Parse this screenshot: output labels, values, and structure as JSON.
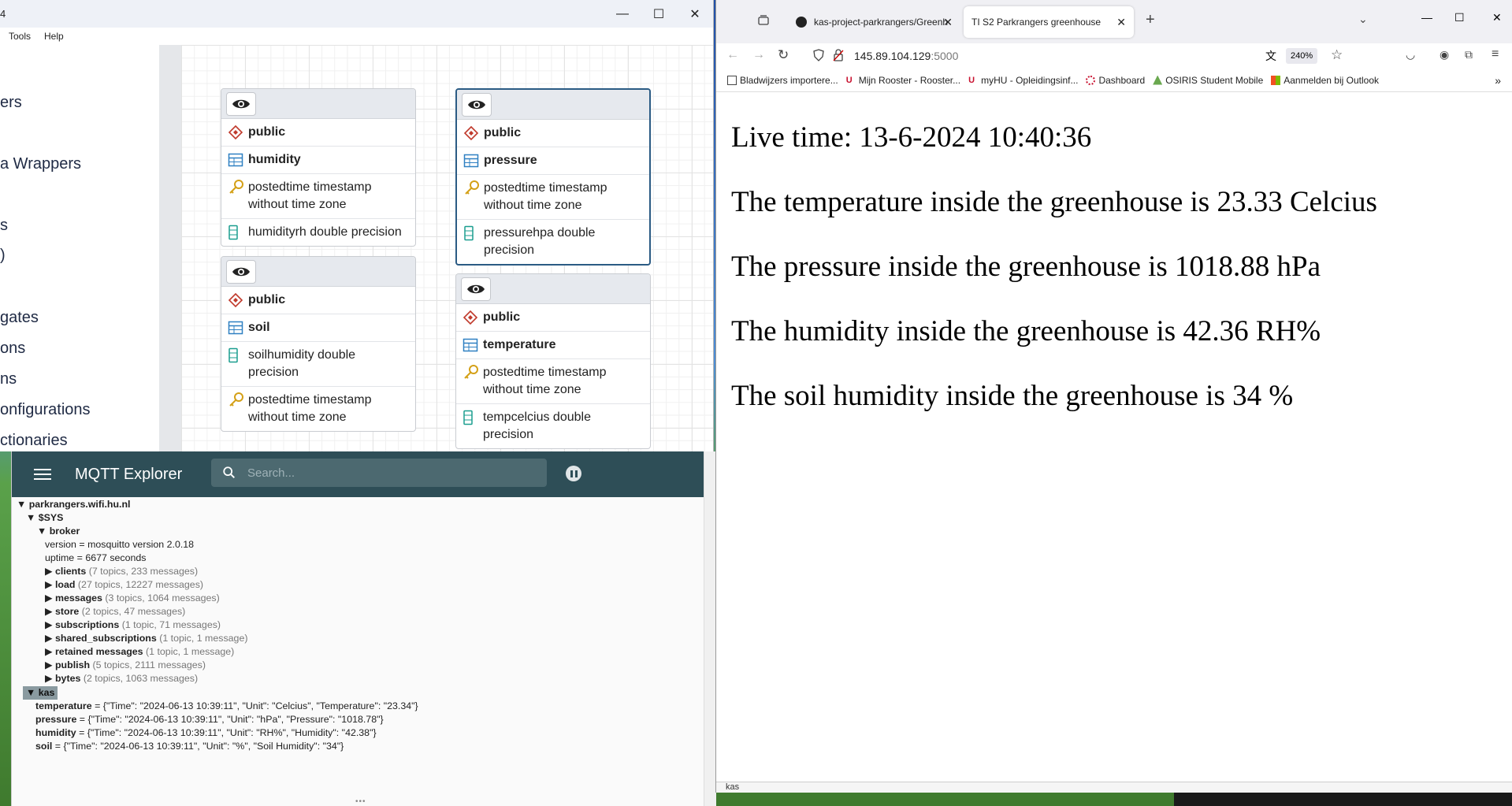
{
  "pgadmin": {
    "title": "4",
    "menu": [
      "Tools",
      "Help"
    ],
    "tree_items": [
      "ers",
      "a Wrappers",
      "s",
      ")",
      "gates",
      "ons",
      "ns",
      "onfigurations",
      "ctionaries"
    ],
    "nodes": [
      {
        "schema": "public",
        "table": "humidity",
        "rows": [
          {
            "icon": "key",
            "text": "postedtime timestamp without time zone"
          },
          {
            "icon": "column",
            "text": "humidityrh double precision"
          }
        ]
      },
      {
        "schema": "public",
        "table": "pressure",
        "rows": [
          {
            "icon": "key",
            "text": "postedtime timestamp without time zone"
          },
          {
            "icon": "column",
            "text": "pressurehpa double precision"
          }
        ]
      },
      {
        "schema": "public",
        "table": "soil",
        "rows": [
          {
            "icon": "column",
            "text": "soilhumidity double precision"
          },
          {
            "icon": "key",
            "text": "postedtime timestamp without time zone"
          }
        ]
      },
      {
        "schema": "public",
        "table": "temperature",
        "rows": [
          {
            "icon": "key",
            "text": "postedtime timestamp without time zone"
          },
          {
            "icon": "column",
            "text": "tempcelcius double precision"
          }
        ]
      }
    ]
  },
  "mqtt": {
    "title": "MQTT Explorer",
    "search_placeholder": "Search...",
    "root": "parkrangers.wifi.hu.nl",
    "sys": "$SYS",
    "broker": "broker",
    "version_label": "version",
    "version_value": "mosquitto version 2.0.18",
    "uptime_label": "uptime",
    "uptime_value": "6677 seconds",
    "groups": [
      {
        "name": "clients",
        "meta": "(7 topics, 233 messages)"
      },
      {
        "name": "load",
        "meta": "(27 topics, 12227 messages)"
      },
      {
        "name": "messages",
        "meta": "(3 topics, 1064 messages)"
      },
      {
        "name": "store",
        "meta": "(2 topics, 47 messages)"
      },
      {
        "name": "subscriptions",
        "meta": "(1 topic, 71 messages)"
      },
      {
        "name": "shared_subscriptions",
        "meta": "(1 topic, 1 message)"
      },
      {
        "name": "retained messages",
        "meta": "(1 topic, 1 message)"
      },
      {
        "name": "publish",
        "meta": "(5 topics, 2111 messages)"
      },
      {
        "name": "bytes",
        "meta": "(2 topics, 1063 messages)"
      }
    ],
    "kas": "kas",
    "kas_topics": [
      {
        "name": "temperature",
        "value": "{\"Time\": \"2024-06-13 10:39:11\", \"Unit\": \"Celcius\", \"Temperature\": \"23.34\"}"
      },
      {
        "name": "pressure",
        "value": "{\"Time\": \"2024-06-13 10:39:11\", \"Unit\": \"hPa\", \"Pressure\": \"1018.78\"}"
      },
      {
        "name": "humidity",
        "value": "{\"Time\": \"2024-06-13 10:39:11\", \"Unit\": \"RH%\", \"Humidity\": \"42.38\"}"
      },
      {
        "name": "soil",
        "value": "{\"Time\": \"2024-06-13 10:39:11\", \"Unit\": \"%\", \"Soil Humidity\": \"34\"}"
      }
    ]
  },
  "firefox": {
    "tabs": [
      {
        "label": "kas-project-parkrangers/Greenh"
      },
      {
        "label": "TI S2 Parkrangers greenhouse"
      }
    ],
    "url_host": "145.89.104.129",
    "url_port": ":5000",
    "zoom": "240%",
    "bookmarks": [
      "Bladwijzers importere...",
      "Mijn Rooster - Rooster...",
      "myHU - Opleidingsinf...",
      "Dashboard",
      "OSIRIS Student Mobile",
      "Aanmelden bij Outlook"
    ],
    "content": [
      "Live time: 13-6-2024 10:40:36",
      "The temperature inside the greenhouse is 23.33 Celcius",
      "The pressure inside the greenhouse is 1018.88 hPa",
      "The humidity inside the greenhouse is 42.36 RH%",
      "The soil humidity inside the greenhouse is 34 %"
    ],
    "bottom_text": "kas"
  },
  "colors": {
    "mqtt_bar": "#2e4e57",
    "erd_selected": "#2b5b84",
    "schema_icon": "#c0392b",
    "key_icon": "#d4a017",
    "table_icon": "#2f80c2",
    "column_icon": "#1a9e8f"
  }
}
